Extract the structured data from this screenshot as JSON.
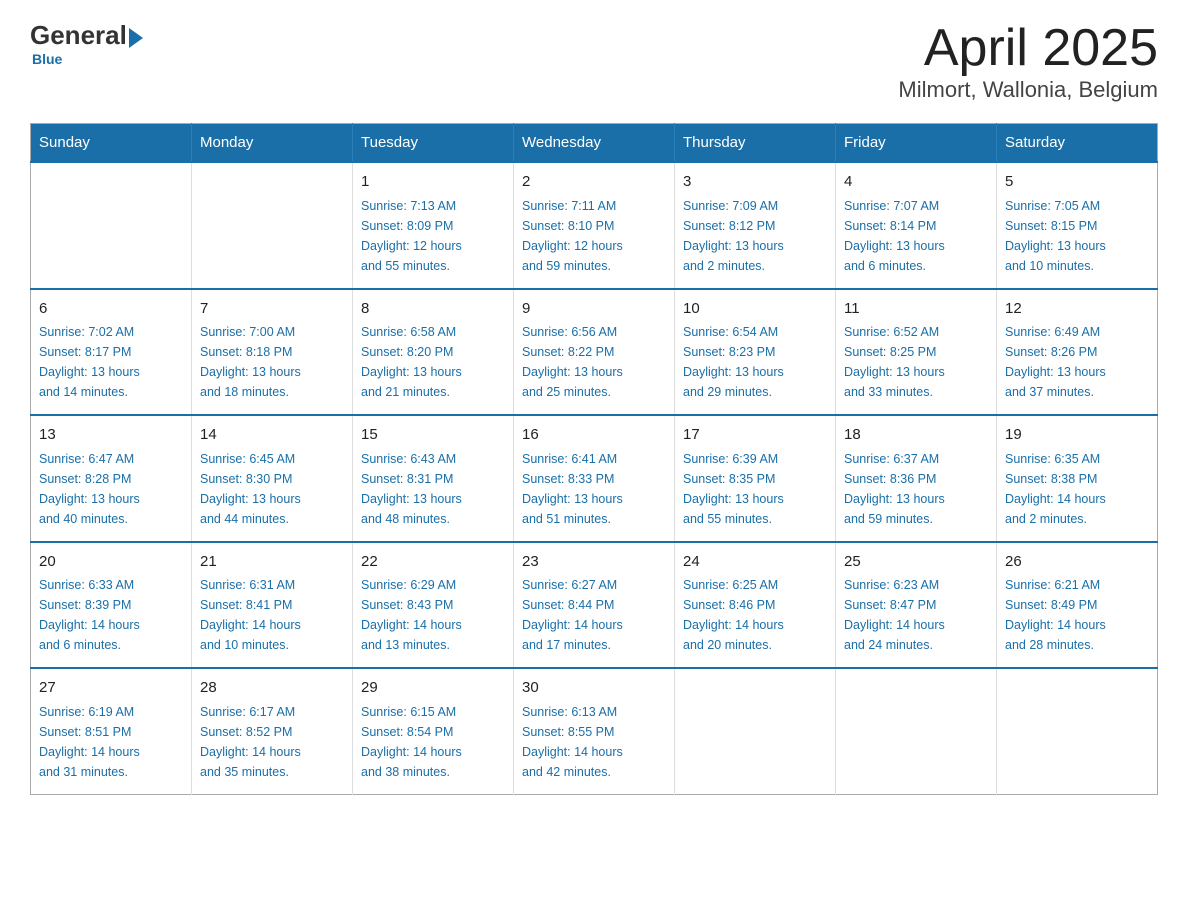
{
  "header": {
    "logo_general": "General",
    "logo_blue": "Blue",
    "title": "April 2025",
    "subtitle": "Milmort, Wallonia, Belgium"
  },
  "calendar": {
    "days_of_week": [
      "Sunday",
      "Monday",
      "Tuesday",
      "Wednesday",
      "Thursday",
      "Friday",
      "Saturday"
    ],
    "weeks": [
      [
        {
          "day": "",
          "info": ""
        },
        {
          "day": "",
          "info": ""
        },
        {
          "day": "1",
          "info": "Sunrise: 7:13 AM\nSunset: 8:09 PM\nDaylight: 12 hours\nand 55 minutes."
        },
        {
          "day": "2",
          "info": "Sunrise: 7:11 AM\nSunset: 8:10 PM\nDaylight: 12 hours\nand 59 minutes."
        },
        {
          "day": "3",
          "info": "Sunrise: 7:09 AM\nSunset: 8:12 PM\nDaylight: 13 hours\nand 2 minutes."
        },
        {
          "day": "4",
          "info": "Sunrise: 7:07 AM\nSunset: 8:14 PM\nDaylight: 13 hours\nand 6 minutes."
        },
        {
          "day": "5",
          "info": "Sunrise: 7:05 AM\nSunset: 8:15 PM\nDaylight: 13 hours\nand 10 minutes."
        }
      ],
      [
        {
          "day": "6",
          "info": "Sunrise: 7:02 AM\nSunset: 8:17 PM\nDaylight: 13 hours\nand 14 minutes."
        },
        {
          "day": "7",
          "info": "Sunrise: 7:00 AM\nSunset: 8:18 PM\nDaylight: 13 hours\nand 18 minutes."
        },
        {
          "day": "8",
          "info": "Sunrise: 6:58 AM\nSunset: 8:20 PM\nDaylight: 13 hours\nand 21 minutes."
        },
        {
          "day": "9",
          "info": "Sunrise: 6:56 AM\nSunset: 8:22 PM\nDaylight: 13 hours\nand 25 minutes."
        },
        {
          "day": "10",
          "info": "Sunrise: 6:54 AM\nSunset: 8:23 PM\nDaylight: 13 hours\nand 29 minutes."
        },
        {
          "day": "11",
          "info": "Sunrise: 6:52 AM\nSunset: 8:25 PM\nDaylight: 13 hours\nand 33 minutes."
        },
        {
          "day": "12",
          "info": "Sunrise: 6:49 AM\nSunset: 8:26 PM\nDaylight: 13 hours\nand 37 minutes."
        }
      ],
      [
        {
          "day": "13",
          "info": "Sunrise: 6:47 AM\nSunset: 8:28 PM\nDaylight: 13 hours\nand 40 minutes."
        },
        {
          "day": "14",
          "info": "Sunrise: 6:45 AM\nSunset: 8:30 PM\nDaylight: 13 hours\nand 44 minutes."
        },
        {
          "day": "15",
          "info": "Sunrise: 6:43 AM\nSunset: 8:31 PM\nDaylight: 13 hours\nand 48 minutes."
        },
        {
          "day": "16",
          "info": "Sunrise: 6:41 AM\nSunset: 8:33 PM\nDaylight: 13 hours\nand 51 minutes."
        },
        {
          "day": "17",
          "info": "Sunrise: 6:39 AM\nSunset: 8:35 PM\nDaylight: 13 hours\nand 55 minutes."
        },
        {
          "day": "18",
          "info": "Sunrise: 6:37 AM\nSunset: 8:36 PM\nDaylight: 13 hours\nand 59 minutes."
        },
        {
          "day": "19",
          "info": "Sunrise: 6:35 AM\nSunset: 8:38 PM\nDaylight: 14 hours\nand 2 minutes."
        }
      ],
      [
        {
          "day": "20",
          "info": "Sunrise: 6:33 AM\nSunset: 8:39 PM\nDaylight: 14 hours\nand 6 minutes."
        },
        {
          "day": "21",
          "info": "Sunrise: 6:31 AM\nSunset: 8:41 PM\nDaylight: 14 hours\nand 10 minutes."
        },
        {
          "day": "22",
          "info": "Sunrise: 6:29 AM\nSunset: 8:43 PM\nDaylight: 14 hours\nand 13 minutes."
        },
        {
          "day": "23",
          "info": "Sunrise: 6:27 AM\nSunset: 8:44 PM\nDaylight: 14 hours\nand 17 minutes."
        },
        {
          "day": "24",
          "info": "Sunrise: 6:25 AM\nSunset: 8:46 PM\nDaylight: 14 hours\nand 20 minutes."
        },
        {
          "day": "25",
          "info": "Sunrise: 6:23 AM\nSunset: 8:47 PM\nDaylight: 14 hours\nand 24 minutes."
        },
        {
          "day": "26",
          "info": "Sunrise: 6:21 AM\nSunset: 8:49 PM\nDaylight: 14 hours\nand 28 minutes."
        }
      ],
      [
        {
          "day": "27",
          "info": "Sunrise: 6:19 AM\nSunset: 8:51 PM\nDaylight: 14 hours\nand 31 minutes."
        },
        {
          "day": "28",
          "info": "Sunrise: 6:17 AM\nSunset: 8:52 PM\nDaylight: 14 hours\nand 35 minutes."
        },
        {
          "day": "29",
          "info": "Sunrise: 6:15 AM\nSunset: 8:54 PM\nDaylight: 14 hours\nand 38 minutes."
        },
        {
          "day": "30",
          "info": "Sunrise: 6:13 AM\nSunset: 8:55 PM\nDaylight: 14 hours\nand 42 minutes."
        },
        {
          "day": "",
          "info": ""
        },
        {
          "day": "",
          "info": ""
        },
        {
          "day": "",
          "info": ""
        }
      ]
    ]
  }
}
